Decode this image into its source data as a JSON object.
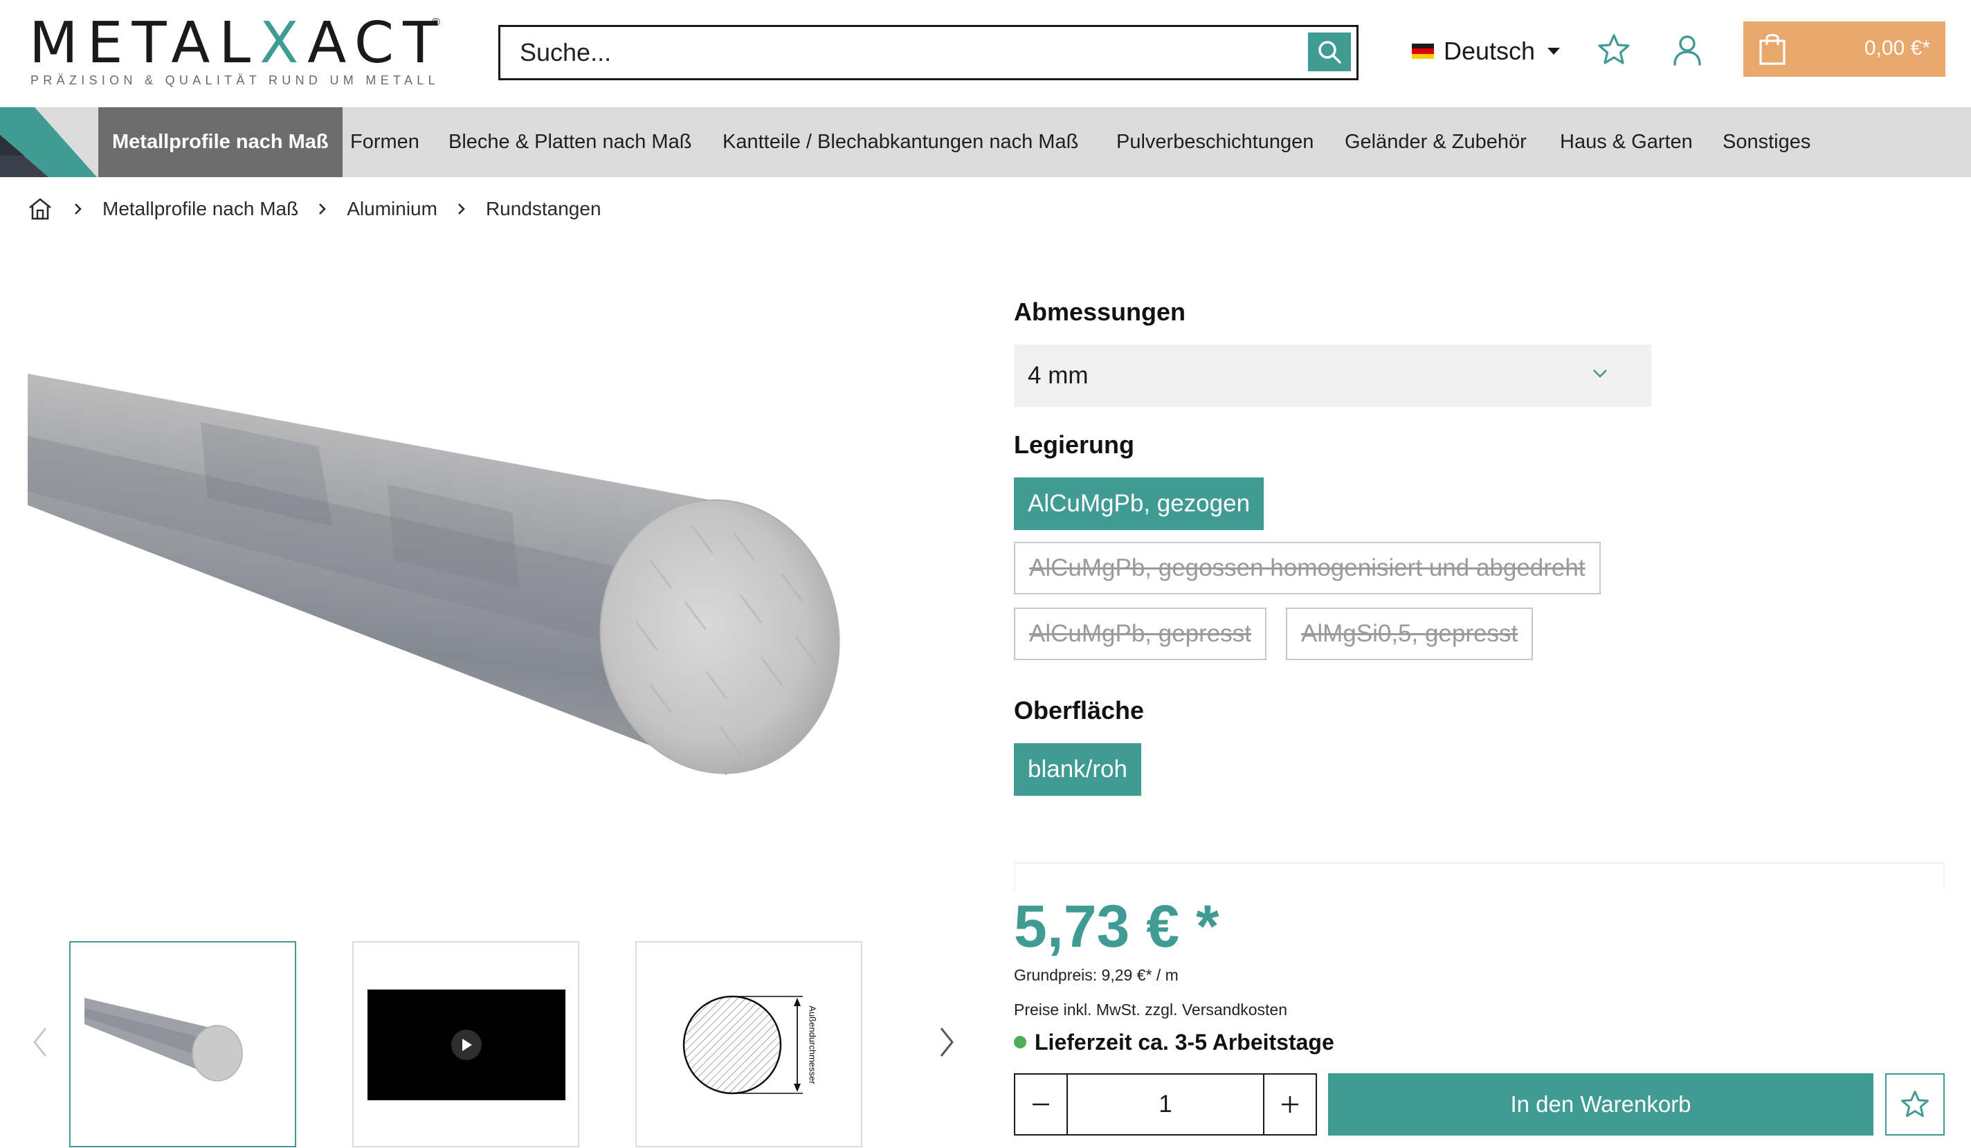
{
  "brand": {
    "name_left": "METAL",
    "name_x": "X",
    "name_right": "ACT",
    "registered": "®",
    "tagline": "PRÄZISION & QUALITÄT RUND UM METALL"
  },
  "header": {
    "search_placeholder": "Suche...",
    "search_icon": "search-icon",
    "language": "Deutsch",
    "language_flag": "germany-flag-icon",
    "wishlist_icon": "star-icon",
    "account_icon": "user-icon",
    "cart_total": "0,00 €*",
    "cart_icon": "shopping-bag-icon"
  },
  "nav": {
    "items": [
      "Metallprofile nach Maß",
      "Formen",
      "Bleche & Platten nach Maß",
      "Kantteile / Blechabkantungen nach Maß",
      "Pulverbeschichtungen",
      "Geländer & Zubehör",
      "Haus & Garten",
      "Sonstiges"
    ],
    "active_index": 0
  },
  "breadcrumb": {
    "home_icon": "home-icon",
    "items": [
      "Metallprofile nach Maß",
      "Aluminium",
      "Rundstangen"
    ]
  },
  "gallery": {
    "thumbnails": [
      {
        "kind": "image",
        "name": "round-bar-thumbnail"
      },
      {
        "kind": "video",
        "name": "video-thumbnail"
      },
      {
        "kind": "drawing",
        "name": "cross-section-drawing",
        "label": "Außendurchmesser"
      }
    ],
    "active_index": 0,
    "prev_icon": "chevron-left-icon",
    "next_icon": "chevron-right-icon"
  },
  "options": {
    "dimensions": {
      "title": "Abmessungen",
      "value": "4 mm"
    },
    "alloy": {
      "title": "Legierung",
      "choices": [
        {
          "label": "AlCuMgPb, gezogen",
          "state": "selected"
        },
        {
          "label": "AlCuMgPb, gegossen homogenisiert und abgedreht",
          "state": "disabled"
        },
        {
          "label": "AlCuMgPb, gepresst",
          "state": "disabled"
        },
        {
          "label": "AlMgSi0,5, gepresst",
          "state": "disabled"
        }
      ]
    },
    "surface": {
      "title": "Oberfläche",
      "choices": [
        {
          "label": "blank/roh",
          "state": "selected"
        }
      ]
    }
  },
  "buy": {
    "price": "5,73 € *",
    "base_price": "Grundpreis: 9,29 €* / m",
    "tax_note": "Preise inkl. MwSt. zzgl. Versandkosten",
    "delivery": "Lieferzeit ca. 3-5 Arbeitstage",
    "delivery_status_color": "#4cb05a",
    "quantity": "1",
    "add_to_cart": "In den Warenkorb"
  },
  "colors": {
    "accent": "#3f9b93",
    "cart": "#e9a76e",
    "nav_bg": "#dcdcdc",
    "nav_active": "#6c6c6c"
  }
}
